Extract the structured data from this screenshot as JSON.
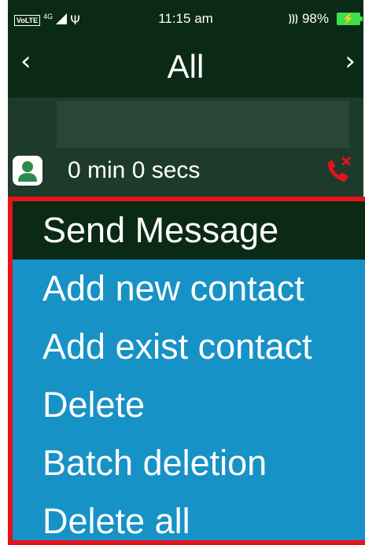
{
  "status_bar": {
    "volte": "VoLTE",
    "network": "4G",
    "usb_icon": "usb-icon",
    "time": "11:15 am",
    "battery": "98%",
    "signal_icon": "wifi-signal-icon",
    "battery_icon": "battery-charging-icon",
    "battery_color": "#3de04a"
  },
  "header": {
    "title": "All",
    "prev_label": "‹",
    "next_label": "›"
  },
  "call_log": {
    "duration": "0 min 0 secs",
    "avatar_icon": "person-avatar-icon",
    "status_icon": "missed-call-icon",
    "status_color": "#e8111a"
  },
  "menu": {
    "items": [
      {
        "label": "Send Message",
        "selected": true
      },
      {
        "label": "Add new contact",
        "selected": false
      },
      {
        "label": "Add exist contact",
        "selected": false
      },
      {
        "label": "Delete",
        "selected": false
      },
      {
        "label": "Batch deletion",
        "selected": false
      },
      {
        "label": "Delete all",
        "selected": false
      }
    ],
    "accent": "#1692c6",
    "selected_bg": "#0b2a15",
    "border_color": "#e8111a"
  }
}
